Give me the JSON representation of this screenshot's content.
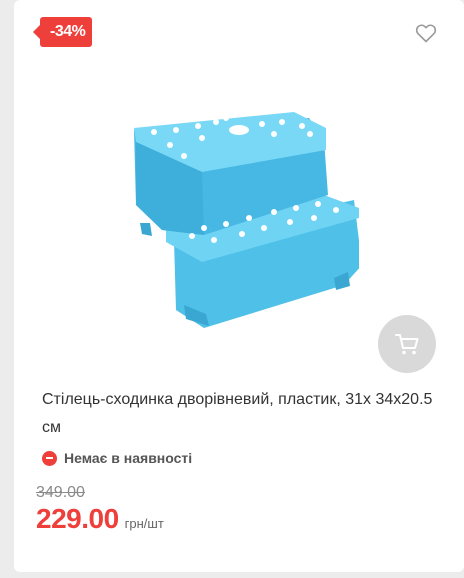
{
  "product": {
    "discount_badge": "-34%",
    "title": "Стілець-сходинка дворівневий, пластик, 31x 34x20.5 см",
    "stock_status": "Немає в наявності",
    "old_price": "349.00",
    "price": "229.00",
    "unit": "грн/шт",
    "image_icon": "step-stool-image",
    "favorite_icon": "heart-icon",
    "cart_icon": "cart-icon"
  },
  "colors": {
    "accent": "#ee3f3b",
    "product_blue": "#55c9ee",
    "cart_button_bg": "#d9d9d9"
  }
}
